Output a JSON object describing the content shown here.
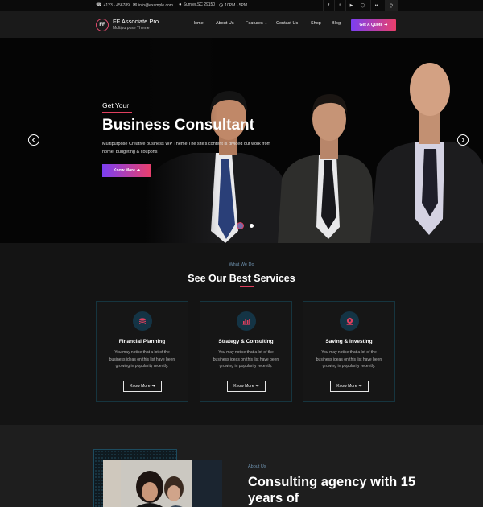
{
  "topbar": {
    "phone": "+123 - 456789",
    "email": "info@example.com",
    "address": "Sumter,SC 29150",
    "hours": "10PM - 5PM",
    "icons": [
      "phone-icon",
      "mail-icon",
      "location-icon",
      "clock-icon",
      "facebook-icon",
      "twitter-icon",
      "youtube-icon",
      "flickr-icon",
      "search-icon"
    ]
  },
  "header": {
    "logo_mark": "FF",
    "logo_title": "FF Associate Pro",
    "logo_subtitle": "Multipurpose Theme",
    "nav": [
      "Home",
      "About Us",
      "Features",
      "Contact Us",
      "Shop",
      "Blog"
    ],
    "quote_button": "Get A Quote",
    "colors": {
      "accent_start": "#7b3ff2",
      "accent_end": "#ea3f6b"
    }
  },
  "hero": {
    "kicker": "Get Your",
    "title": "Business Consultant",
    "text": "Multipurpose Creative business WP Theme The site's content is divided out work from home, budgeting & coupons",
    "button": "Know More",
    "slides_total": 2,
    "active_slide": 1
  },
  "services": {
    "kicker": "What We Do",
    "title": "See Our Best Services",
    "cards": [
      {
        "icon": "coins-icon",
        "title": "Financial Planning",
        "text": "You may notice that a lot of the business ideas on this list have been growing in popularity recently.",
        "button": "Know More"
      },
      {
        "icon": "bar-chart-icon",
        "title": "Strategy & Consulting",
        "text": "You may notice that a lot of the business ideas on this list have been growing in popularity recently.",
        "button": "Know More"
      },
      {
        "icon": "piggy-bank-icon",
        "title": "Saving & Investing",
        "text": "You may notice that a lot of the business ideas on this list have been growing in popularity recently.",
        "button": "Know More"
      }
    ]
  },
  "about": {
    "kicker": "About Us",
    "title": "Consulting agency with 15 years of"
  }
}
